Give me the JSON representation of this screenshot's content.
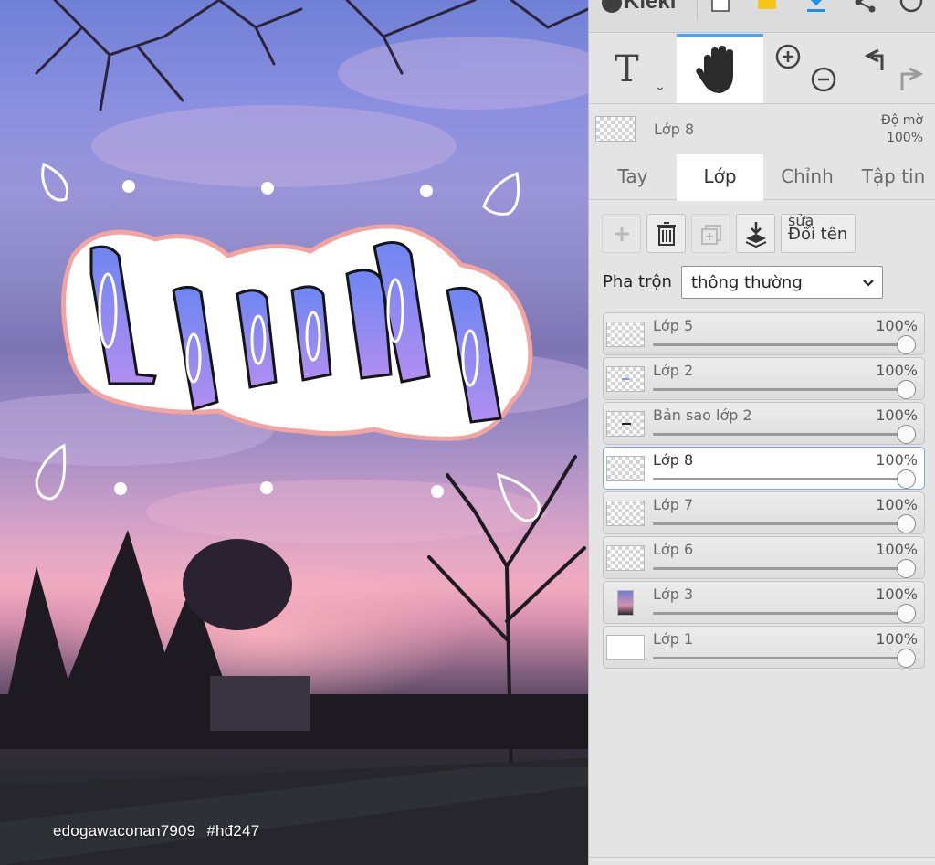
{
  "app": {
    "name": "Kleki"
  },
  "canvas": {
    "credit_user": "edogawaconan7909",
    "credit_tag": "#hđ247"
  },
  "toolbar": {
    "tools": [
      {
        "name": "text",
        "icon": "text-tool-icon"
      },
      {
        "name": "hand",
        "icon": "hand-icon",
        "active": true
      },
      {
        "name": "zoom",
        "icon": "zoom-in-out-icon"
      },
      {
        "name": "undo-redo",
        "icon": "undo-redo-icon"
      }
    ]
  },
  "current_layer": {
    "name": "Lớp 8",
    "opacity_label": "Độ mờ",
    "opacity_value": "100%"
  },
  "tabs": [
    {
      "label": "Tay",
      "active": false
    },
    {
      "label": "Lớp",
      "active": true
    },
    {
      "label": "Chỉnh",
      "active": false
    },
    {
      "label": "Tập tin",
      "active": false
    }
  ],
  "layer_actions": {
    "rename_top": "sửa",
    "rename": "Đổi tên"
  },
  "blend": {
    "label": "Pha trộn",
    "value": "thông thường"
  },
  "layers": [
    {
      "name": "Lớp 5",
      "opacity": "100%",
      "opacity_fraction": 1.0,
      "thumb": "checker"
    },
    {
      "name": "Lớp 2",
      "opacity": "100%",
      "opacity_fraction": 1.0,
      "thumb": "checker"
    },
    {
      "name": "Bản sao lớp 2",
      "opacity": "100%",
      "opacity_fraction": 1.0,
      "thumb": "checker"
    },
    {
      "name": "Lớp 8",
      "opacity": "100%",
      "opacity_fraction": 1.0,
      "thumb": "checker",
      "selected": true
    },
    {
      "name": "Lớp 7",
      "opacity": "100%",
      "opacity_fraction": 1.0,
      "thumb": "checker"
    },
    {
      "name": "Lớp 6",
      "opacity": "100%",
      "opacity_fraction": 1.0,
      "thumb": "checker"
    },
    {
      "name": "Lớp 3",
      "opacity": "100%",
      "opacity_fraction": 1.0,
      "thumb": "photo"
    },
    {
      "name": "Lớp 1",
      "opacity": "100%",
      "opacity_fraction": 1.0,
      "thumb": "white"
    }
  ],
  "colors": {
    "accent": "#4aa3f0",
    "selected_border": "#7aa7e0",
    "lettering_top": "#6e86f2",
    "lettering_bottom": "#b18ef0",
    "sticker_outline": "#f3a4a0"
  }
}
